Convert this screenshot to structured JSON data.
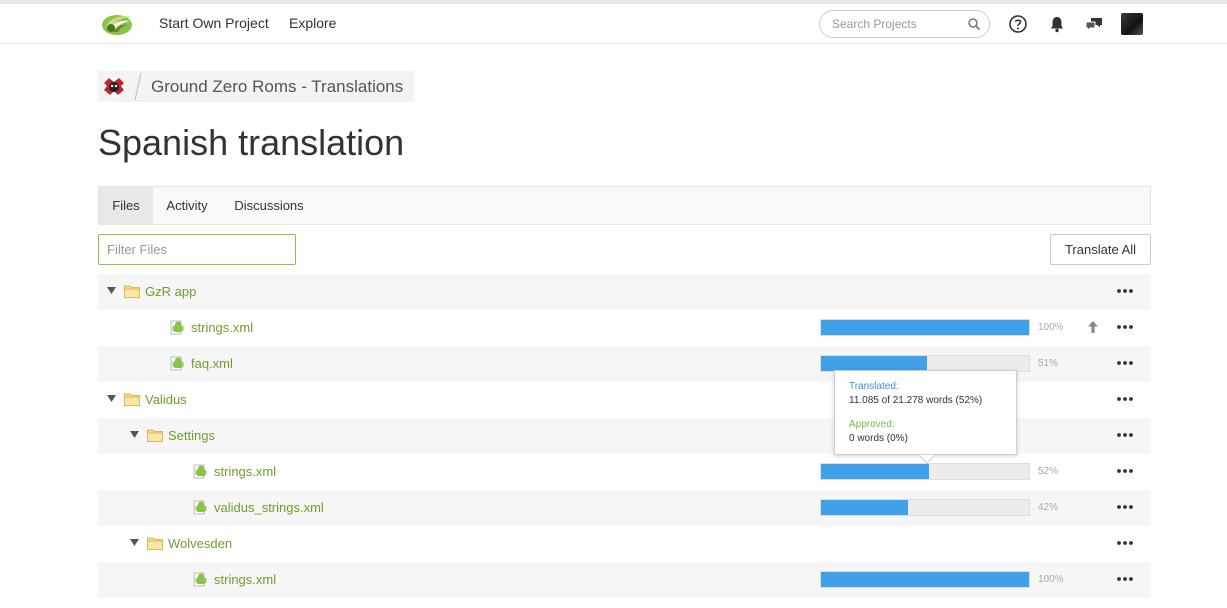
{
  "header": {
    "nav": [
      "Start Own Project",
      "Explore"
    ],
    "search_placeholder": "Search Projects"
  },
  "breadcrumb": {
    "project": "Ground Zero Roms - Translations"
  },
  "page_title": "Spanish translation",
  "tabs": [
    "Files",
    "Activity",
    "Discussions"
  ],
  "active_tab": "Files",
  "filter_placeholder": "Filter Files",
  "translate_all_label": "Translate All",
  "tree": [
    {
      "type": "folder",
      "name": "GzR app",
      "level": 0
    },
    {
      "type": "file",
      "name": "strings.xml",
      "level": 1,
      "progress": 100,
      "pct_label": "100%",
      "uploadable": true
    },
    {
      "type": "file",
      "name": "faq.xml",
      "level": 1,
      "progress": 51,
      "pct_label": "51%"
    },
    {
      "type": "folder",
      "name": "Validus",
      "level": 0
    },
    {
      "type": "folder",
      "name": "Settings",
      "level": 1
    },
    {
      "type": "file",
      "name": "strings.xml",
      "level": 2,
      "progress": 52,
      "pct_label": "52%"
    },
    {
      "type": "file",
      "name": "validus_strings.xml",
      "level": 2,
      "progress": 42,
      "pct_label": "42%"
    },
    {
      "type": "folder",
      "name": "Wolvesden",
      "level": 1
    },
    {
      "type": "file",
      "name": "strings.xml",
      "level": 2,
      "progress": 100,
      "pct_label": "100%"
    }
  ],
  "tooltip": {
    "translated_label": "Translated:",
    "translated_value": "11.085 of 21.278 words (52%)",
    "approved_label": "Approved:",
    "approved_value": "0 words (0%)"
  },
  "colors": {
    "accent_green": "#6f9e2d",
    "progress_blue": "#40a0ea",
    "translated_blue": "#3f8fd2",
    "approved_green": "#7ab648"
  }
}
